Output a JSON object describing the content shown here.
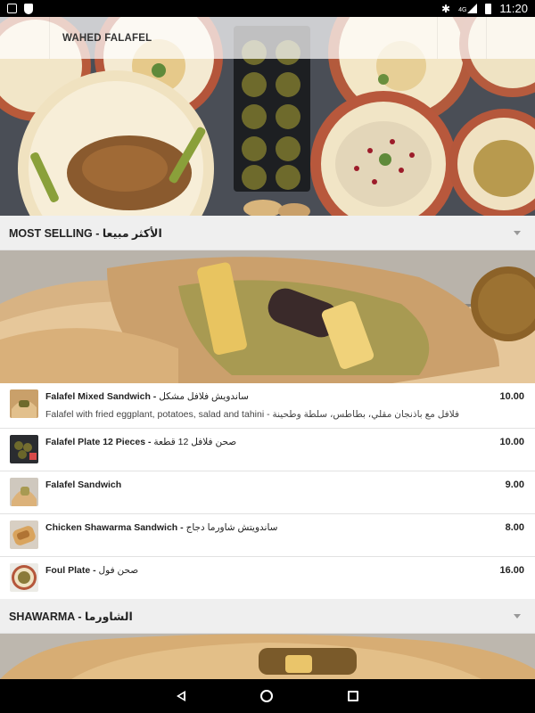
{
  "status_bar": {
    "time": "11:20",
    "left_icons": [
      "clipboard-check-icon",
      "shield-icon"
    ],
    "right_icons": [
      "bluetooth-icon",
      "signal-4g-icon",
      "battery-icon"
    ],
    "network_label": "4G"
  },
  "app_bar": {
    "title": "WAHED FALAFEL"
  },
  "sections": [
    {
      "title": "MOST SELLING - الأكثر مبيعا",
      "expanded": true,
      "items": [
        {
          "name_en": "Falafel Mixed Sandwich",
          "name_ar": "ساندويش فلافل مشكل",
          "description": "Falafel with fried eggplant, potatoes, salad and tahini - فلافل مع باذنجان مقلي، بطاطس، سلطة وطحينة",
          "price": "10.00"
        },
        {
          "name_en": "Falafel Plate 12 Pieces",
          "name_ar": "صحن فلافل 12 قطعة",
          "description": "",
          "price": "10.00"
        },
        {
          "name_en": "Falafel Sandwich",
          "name_ar": "",
          "description": "",
          "price": "9.00"
        },
        {
          "name_en": "Chicken Shawarma Sandwich",
          "name_ar": "ساندويتش شاورما دجاج",
          "description": "",
          "price": "8.00"
        },
        {
          "name_en": "Foul Plate",
          "name_ar": "صحن فول",
          "description": "",
          "price": "16.00"
        }
      ]
    },
    {
      "title": "SHAWARMA - الشاورما",
      "expanded": true,
      "items": []
    }
  ],
  "nav_bar": {
    "buttons": [
      "back-icon",
      "home-icon",
      "recents-icon"
    ]
  },
  "colors": {
    "status_bar": "#000000",
    "section_header_bg": "#efefef",
    "divider": "#e2e2e2",
    "text_primary": "#222222"
  }
}
